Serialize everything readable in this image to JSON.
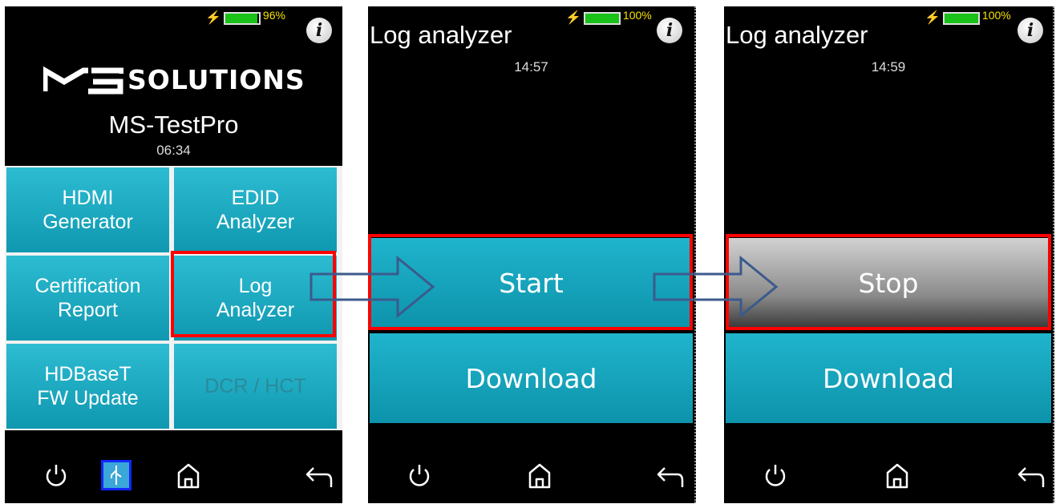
{
  "screen1": {
    "battery_pct": "96%",
    "battery_level": 0.96,
    "info_label": "i",
    "logo_text": "SOLUTIONS",
    "device_name": "MS-TestPro",
    "clock": "06:34",
    "tiles": [
      {
        "label": "HDMI\nGenerator",
        "enabled": true
      },
      {
        "label": "EDID\nAnalyzer",
        "enabled": true
      },
      {
        "label": "Certification\nReport",
        "enabled": true
      },
      {
        "label": "Log\nAnalyzer",
        "enabled": true
      },
      {
        "label": "HDBaseT\nFW Update",
        "enabled": true
      },
      {
        "label": "DCR / HCT",
        "enabled": false
      }
    ]
  },
  "screen2": {
    "battery_pct": "100%",
    "battery_level": 1.0,
    "info_label": "i",
    "title": "Log analyzer",
    "clock": "14:57",
    "primary_button": "Start",
    "secondary_button": "Download"
  },
  "screen3": {
    "battery_pct": "100%",
    "battery_level": 1.0,
    "info_label": "i",
    "title": "Log analyzer",
    "clock": "14:59",
    "primary_button": "Stop",
    "secondary_button": "Download"
  },
  "icons": {
    "power": "power-icon",
    "usb": "usb-icon",
    "home": "home-icon",
    "back": "back-icon",
    "info": "info-icon",
    "arrow": "flow-arrow-icon"
  },
  "colors": {
    "tile_teal": "#1aa9c0",
    "highlight": "#ff0000",
    "battery_green": "#19c119",
    "bolt_yellow": "#f5e100",
    "stop_grey": "#8a8a8a",
    "arrow_outline": "#3b5a8c"
  }
}
